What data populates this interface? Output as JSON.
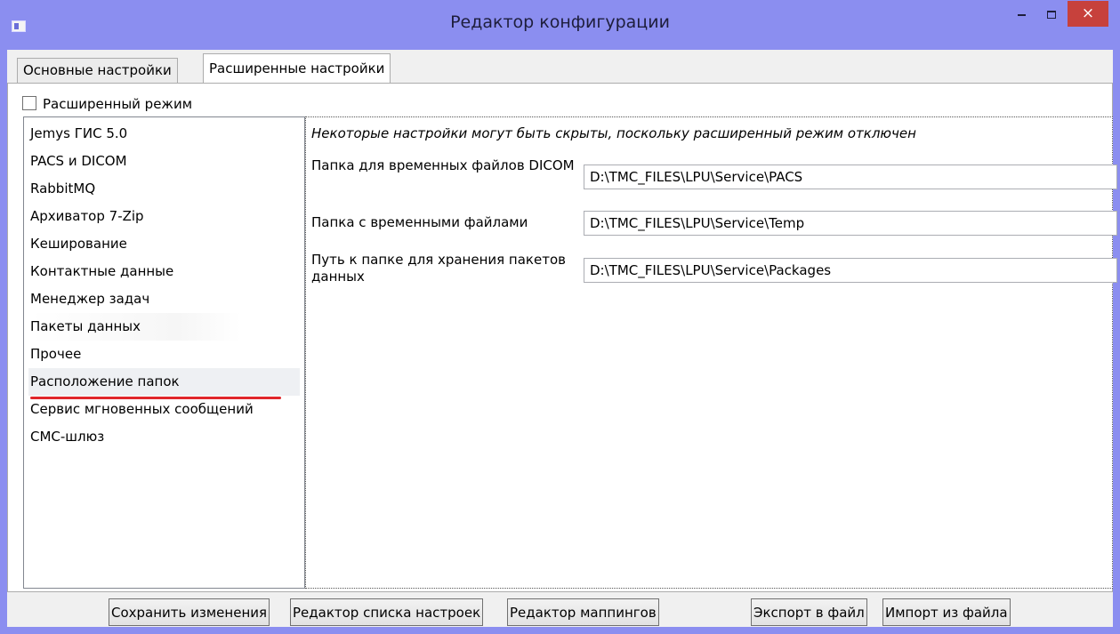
{
  "window": {
    "title": "Редактор конфигурации",
    "icon": "app-icon",
    "controls": {
      "minimize": "minimize-icon",
      "maximize": "maximize-icon",
      "close": "×"
    }
  },
  "tabs": [
    {
      "label": "Основные настройки",
      "active": false
    },
    {
      "label": "Расширенные настройки",
      "active": true
    }
  ],
  "advanced_mode": {
    "label": "Расширенный режим",
    "checked": false
  },
  "categories": [
    "Jemys ГИС 5.0",
    "PACS и DICOM",
    "RabbitMQ",
    "Архиватор 7-Zip",
    "Кеширование",
    "Контактные данные",
    "Менеджер задач",
    "Пакеты данных",
    "Прочее",
    "Расположение папок",
    "Сервис мгновенных сообщений",
    "СМС-шлюз"
  ],
  "selected_category": "Расположение папок",
  "settings": {
    "notice": "Некоторые настройки могут быть скрыты, поскольку расширенный режим отключен",
    "fields": [
      {
        "label": "Папка для временных файлов DICOM",
        "value": "D:\\TMC_FILES\\LPU\\Service\\PACS"
      },
      {
        "label": "Папка с временными файлами",
        "value": "D:\\TMC_FILES\\LPU\\Service\\Temp"
      },
      {
        "label": "Путь к папке для хранения пакетов данных",
        "value": "D:\\TMC_FILES\\LPU\\Service\\Packages"
      }
    ]
  },
  "buttons": {
    "save": "Сохранить изменения",
    "settings_list_editor": "Редактор списка настроек",
    "mapping_editor": "Редактор маппингов",
    "export": "Экспорт в файл",
    "import": "Импорт из файла"
  },
  "colors": {
    "titlebar": "#8b8ef0",
    "close_button": "#c7413c",
    "selection_underline": "#e0262b"
  }
}
